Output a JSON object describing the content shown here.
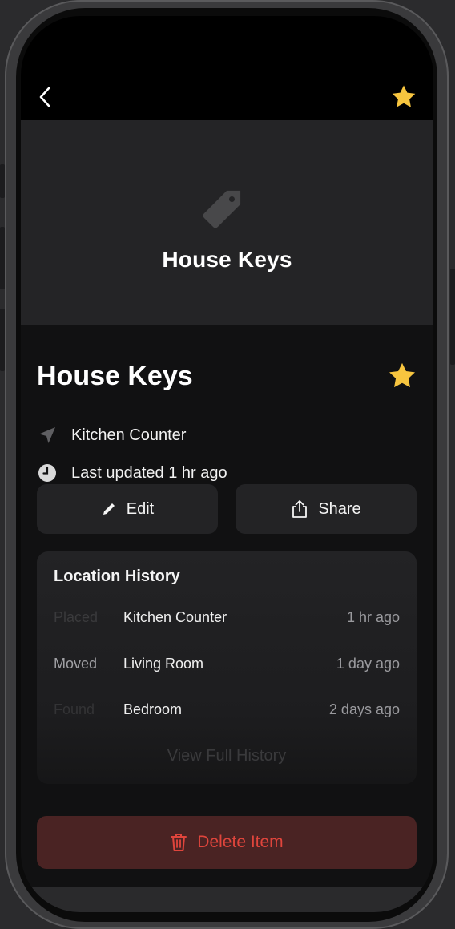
{
  "header": {
    "back_icon": "chevron-left-icon",
    "favorite_icon": "star-icon",
    "accent_color": "#f7c53f"
  },
  "hero": {
    "icon": "tag-icon",
    "title": "House Keys"
  },
  "item": {
    "name": "House Keys",
    "favorite_icon": "star-icon",
    "location": "Kitchen Counter",
    "location_icon": "location-arrow-icon",
    "last_updated": "Last updated 1 hr ago",
    "clock_icon": "clock-icon"
  },
  "actions": {
    "edit_label": "Edit",
    "edit_icon": "pencil-icon",
    "share_label": "Share",
    "share_icon": "share-icon"
  },
  "history": {
    "title": "Location History",
    "rows": [
      {
        "action": "Placed",
        "location": "Kitchen Counter",
        "time": "1 hr ago"
      },
      {
        "action": "Moved",
        "location": "Living Room",
        "time": "1 day ago"
      },
      {
        "action": "Found",
        "location": "Bedroom",
        "time": "2 days ago"
      }
    ],
    "view_full": "View Full History"
  },
  "danger": {
    "delete_label": "Delete Item",
    "delete_icon": "trash-icon",
    "color": "#e0453c"
  }
}
